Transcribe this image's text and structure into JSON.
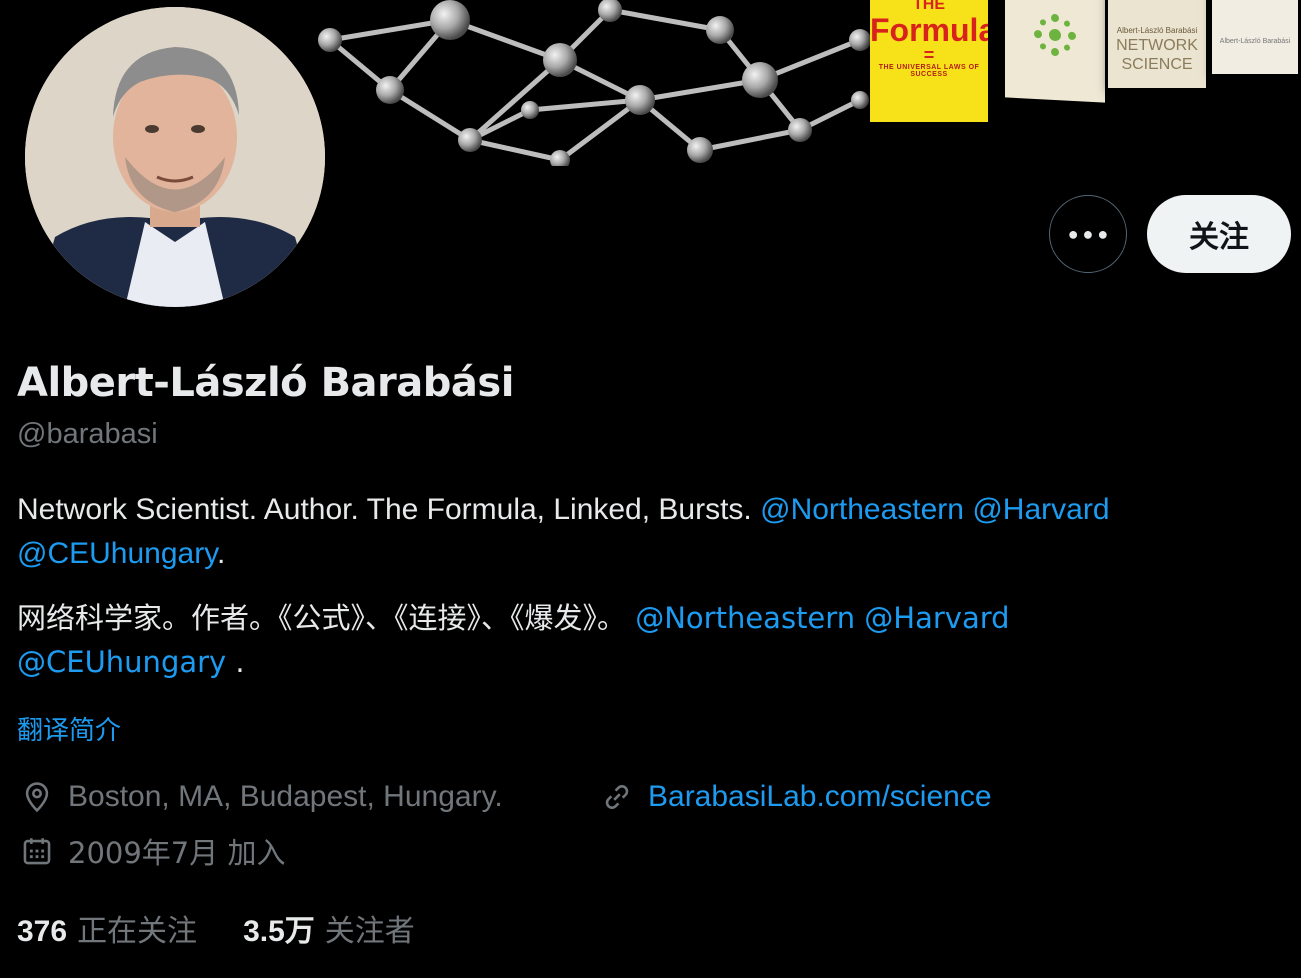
{
  "banner": {
    "books": {
      "formula": {
        "top": "THE",
        "title": "Formula",
        "eq": "=",
        "subtitle": "THE UNIVERSAL LAWS OF SUCCESS"
      },
      "netsci": {
        "author": "Albert-László Barabási",
        "title_1": "NETWORK",
        "title_2": "SCIENCE"
      },
      "bursts": {
        "author": "Albert-László Barabási"
      }
    }
  },
  "actions": {
    "more_label": "•••",
    "follow_label": "关注"
  },
  "profile": {
    "name": "Albert-László Barabási",
    "handle": "@barabasi",
    "bio_en_text": "Network Scientist. Author. The Formula, Linked, Bursts. ",
    "bio_en_mention_1": "@Northeastern",
    "bio_en_mention_2": "@Harvard",
    "bio_en_mention_3": "@CEUhungary",
    "bio_en_tail": ".",
    "bio_zh_text": "网络科学家。作者。《公式》、《连接》、《爆发》。 ",
    "bio_zh_mention_1": "@Northeastern",
    "bio_zh_mention_2": "@Harvard",
    "bio_zh_mention_3": "@CEUhungary",
    "bio_zh_tail": " .",
    "translate_label": "翻译简介",
    "location": "Boston, MA, Budapest, Hungary.",
    "website": "BarabasiLab.com/science",
    "joined": "2009年7月 加入"
  },
  "stats": {
    "following_count": "376",
    "following_label": "正在关注",
    "followers_count": "3.5万",
    "followers_label": "关注者"
  },
  "colors": {
    "background": "#000000",
    "text": "#e7e9ea",
    "muted": "#71767b",
    "accent": "#1d9bf0"
  }
}
